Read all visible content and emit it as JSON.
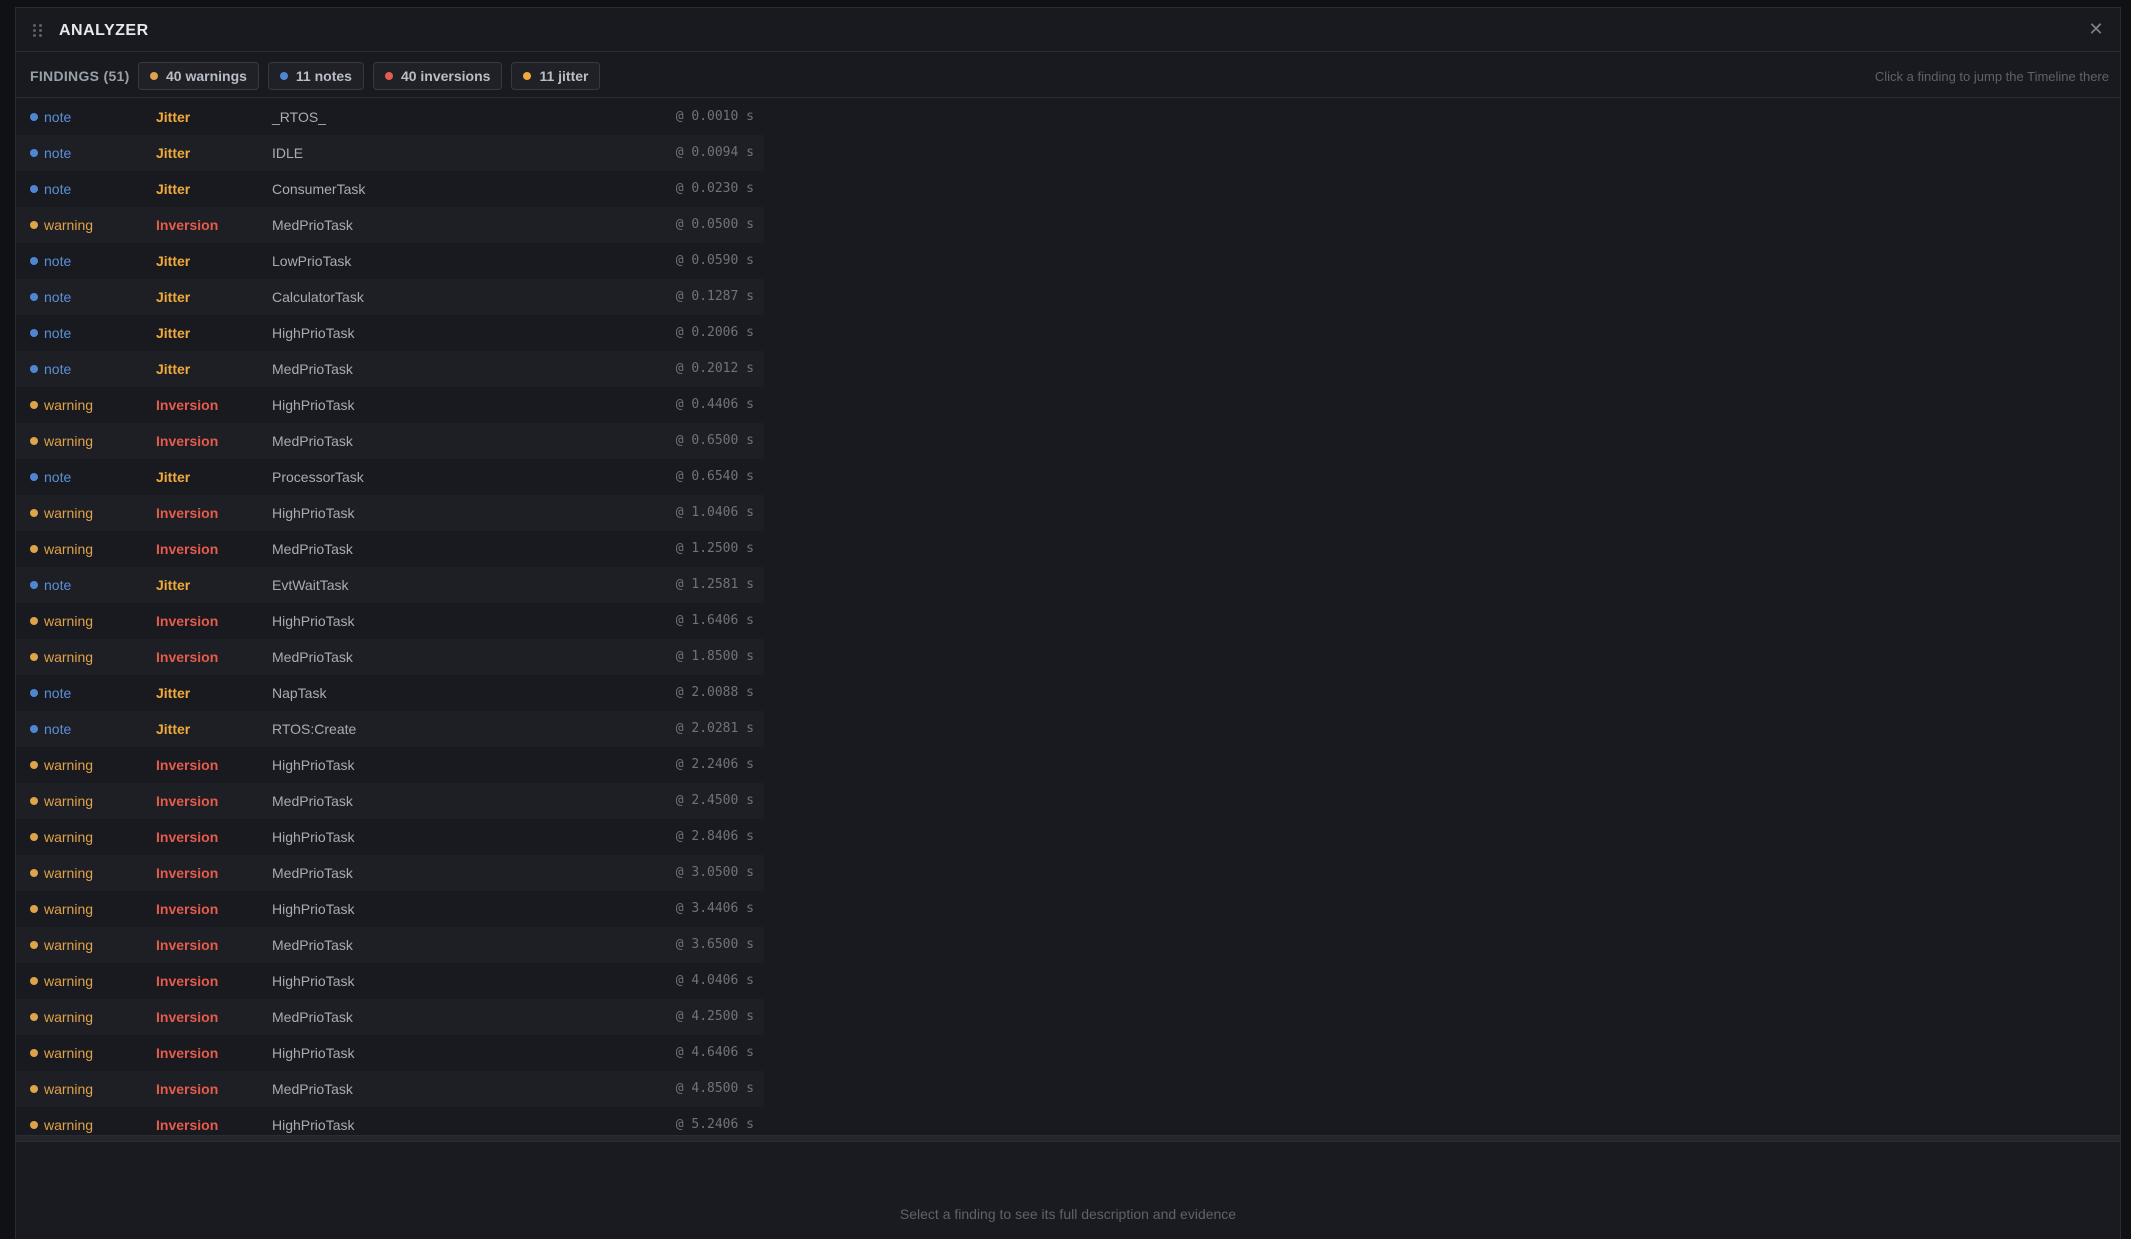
{
  "panel": {
    "title": "ANALYZER",
    "close_glyph": "✕"
  },
  "filters": {
    "findings_label": "FINDINGS (51)",
    "chips": [
      {
        "label": "40 warnings",
        "color": "#e0a24a"
      },
      {
        "label": "11 notes",
        "color": "#4f86d4"
      },
      {
        "label": "40 inversions",
        "color": "#e55b4d"
      },
      {
        "label": "11 jitter",
        "color": "#f0a93a"
      }
    ],
    "hint": "Click a finding to jump the Timeline there"
  },
  "colors": {
    "note": "#4f86d4",
    "warning": "#e0a24a",
    "jitter": "#f0a93a",
    "inversion": "#e55b4d"
  },
  "findings": [
    {
      "severity": "note",
      "kind": "Jitter",
      "task": "_RTOS_",
      "time": "@ 0.0010 s"
    },
    {
      "severity": "note",
      "kind": "Jitter",
      "task": "IDLE",
      "time": "@ 0.0094 s"
    },
    {
      "severity": "note",
      "kind": "Jitter",
      "task": "ConsumerTask",
      "time": "@ 0.0230 s"
    },
    {
      "severity": "warning",
      "kind": "Inversion",
      "task": "MedPrioTask",
      "time": "@ 0.0500 s"
    },
    {
      "severity": "note",
      "kind": "Jitter",
      "task": "LowPrioTask",
      "time": "@ 0.0590 s"
    },
    {
      "severity": "note",
      "kind": "Jitter",
      "task": "CalculatorTask",
      "time": "@ 0.1287 s"
    },
    {
      "severity": "note",
      "kind": "Jitter",
      "task": "HighPrioTask",
      "time": "@ 0.2006 s"
    },
    {
      "severity": "note",
      "kind": "Jitter",
      "task": "MedPrioTask",
      "time": "@ 0.2012 s"
    },
    {
      "severity": "warning",
      "kind": "Inversion",
      "task": "HighPrioTask",
      "time": "@ 0.4406 s"
    },
    {
      "severity": "warning",
      "kind": "Inversion",
      "task": "MedPrioTask",
      "time": "@ 0.6500 s"
    },
    {
      "severity": "note",
      "kind": "Jitter",
      "task": "ProcessorTask",
      "time": "@ 0.6540 s"
    },
    {
      "severity": "warning",
      "kind": "Inversion",
      "task": "HighPrioTask",
      "time": "@ 1.0406 s"
    },
    {
      "severity": "warning",
      "kind": "Inversion",
      "task": "MedPrioTask",
      "time": "@ 1.2500 s"
    },
    {
      "severity": "note",
      "kind": "Jitter",
      "task": "EvtWaitTask",
      "time": "@ 1.2581 s"
    },
    {
      "severity": "warning",
      "kind": "Inversion",
      "task": "HighPrioTask",
      "time": "@ 1.6406 s"
    },
    {
      "severity": "warning",
      "kind": "Inversion",
      "task": "MedPrioTask",
      "time": "@ 1.8500 s"
    },
    {
      "severity": "note",
      "kind": "Jitter",
      "task": "NapTask",
      "time": "@ 2.0088 s"
    },
    {
      "severity": "note",
      "kind": "Jitter",
      "task": "RTOS:Create",
      "time": "@ 2.0281 s"
    },
    {
      "severity": "warning",
      "kind": "Inversion",
      "task": "HighPrioTask",
      "time": "@ 2.2406 s"
    },
    {
      "severity": "warning",
      "kind": "Inversion",
      "task": "MedPrioTask",
      "time": "@ 2.4500 s"
    },
    {
      "severity": "warning",
      "kind": "Inversion",
      "task": "HighPrioTask",
      "time": "@ 2.8406 s"
    },
    {
      "severity": "warning",
      "kind": "Inversion",
      "task": "MedPrioTask",
      "time": "@ 3.0500 s"
    },
    {
      "severity": "warning",
      "kind": "Inversion",
      "task": "HighPrioTask",
      "time": "@ 3.4406 s"
    },
    {
      "severity": "warning",
      "kind": "Inversion",
      "task": "MedPrioTask",
      "time": "@ 3.6500 s"
    },
    {
      "severity": "warning",
      "kind": "Inversion",
      "task": "HighPrioTask",
      "time": "@ 4.0406 s"
    },
    {
      "severity": "warning",
      "kind": "Inversion",
      "task": "MedPrioTask",
      "time": "@ 4.2500 s"
    },
    {
      "severity": "warning",
      "kind": "Inversion",
      "task": "HighPrioTask",
      "time": "@ 4.6406 s"
    },
    {
      "severity": "warning",
      "kind": "Inversion",
      "task": "MedPrioTask",
      "time": "@ 4.8500 s"
    },
    {
      "severity": "warning",
      "kind": "Inversion",
      "task": "HighPrioTask",
      "time": "@ 5.2406 s"
    }
  ],
  "detail": {
    "placeholder": "Select a finding to see its full description and evidence"
  }
}
